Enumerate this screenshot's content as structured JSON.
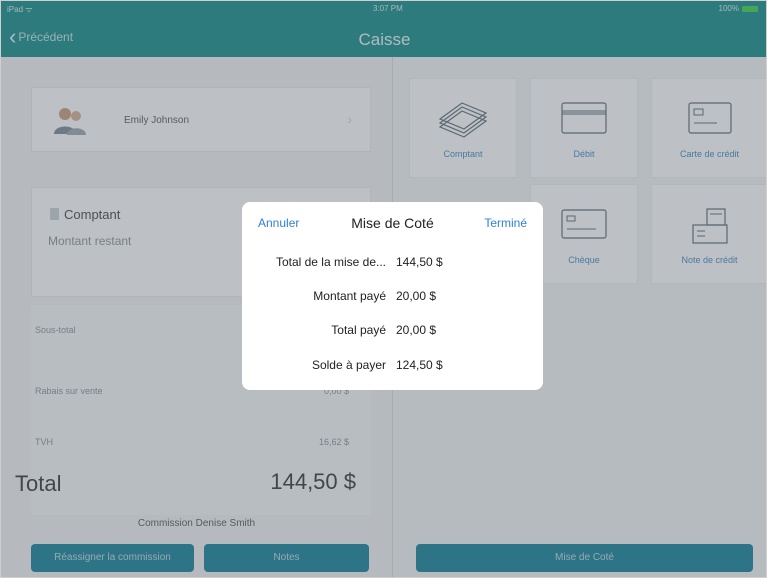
{
  "status": {
    "carrier": "iPad ᯤ",
    "time": "3:07 PM",
    "battery": "100%"
  },
  "nav": {
    "back_label": "Précédent",
    "title": "Caisse"
  },
  "customer": {
    "name": "Emily Johnson"
  },
  "payment": {
    "method": "Comptant",
    "remaining_label": "Montant restant"
  },
  "totals": {
    "subtotal_label": "Sous-total",
    "discount_label": "Rabais sur vente",
    "discount_value": "0,00 $",
    "tax_label": "TVH",
    "tax_value": "16,62 $",
    "total_label": "Total",
    "total_value": "144,50 $"
  },
  "commission": "Commission Denise Smith",
  "buttons": {
    "reassign": "Réassigner la commission",
    "notes": "Notes",
    "layaway": "Mise de Coté"
  },
  "tiles": {
    "cash": "Comptant",
    "debit": "Débit",
    "credit_card": "Carte de crédit",
    "cheque": "Chèque",
    "credit_note": "Note de crédit"
  },
  "modal": {
    "cancel": "Annuler",
    "title": "Mise de Coté",
    "done": "Terminé",
    "rows": [
      {
        "label": "Total de la mise de...",
        "value": "144,50 $"
      },
      {
        "label": "Montant payé",
        "value": "20,00 $"
      },
      {
        "label": "Total payé",
        "value": "20,00 $"
      },
      {
        "label": "Solde à payer",
        "value": "124,50 $"
      }
    ]
  },
  "colors": {
    "bar": "#118a88",
    "button": "#107f97",
    "link": "#2f7fd6"
  }
}
